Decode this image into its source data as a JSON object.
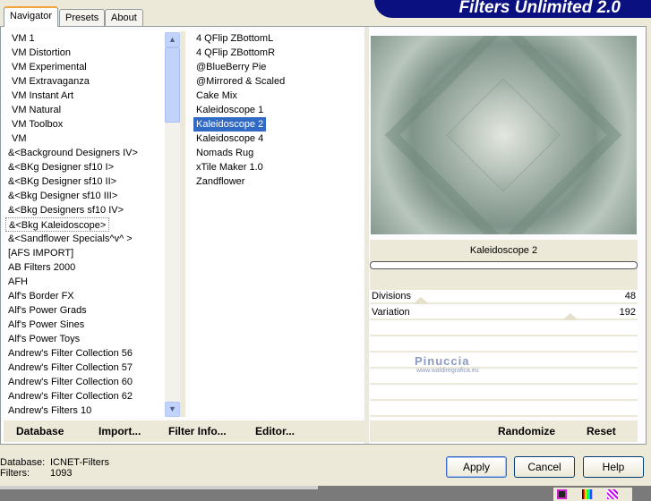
{
  "app": {
    "title": "Filters Unlimited 2.0"
  },
  "tabs": [
    {
      "label": "Navigator"
    },
    {
      "label": "Presets"
    },
    {
      "label": "About"
    }
  ],
  "categories": [
    "VM 1",
    "VM Distortion",
    "VM Experimental",
    "VM Extravaganza",
    "VM Instant Art",
    "VM Natural",
    "VM Toolbox",
    "VM",
    "&<Background Designers IV>",
    "&<BKg Designer sf10 I>",
    "&<BKg Designer sf10 II>",
    "&<Bkg Designer sf10 III>",
    "&<Bkg Designers sf10 IV>",
    "&<Bkg Kaleidoscope>",
    "&<Sandflower Specials^v^ >",
    "[AFS IMPORT]",
    "AB Filters 2000",
    "AFH",
    "Alf's Border FX",
    "Alf's Power Grads",
    "Alf's Power Sines",
    "Alf's Power Toys",
    "Andrew's Filter Collection 56",
    "Andrew's Filter Collection 57",
    "Andrew's Filter Collection 60",
    "Andrew's Filter Collection 62",
    "Andrew's Filters 10"
  ],
  "selected_category": "&<Bkg Kaleidoscope>",
  "filters": [
    "4 QFlip ZBottomL",
    "4 QFlip ZBottomR",
    "@BlueBerry Pie",
    "@Mirrored & Scaled",
    "Cake Mix",
    "Kaleidoscope 1",
    "Kaleidoscope 2",
    "Kaleidoscope 4",
    "Nomads Rug",
    "xTile Maker 1.0",
    "Zandflower"
  ],
  "selected_filter": "Kaleidoscope 2",
  "filter_name": "Kaleidoscope 2",
  "params": [
    {
      "label": "Divisions",
      "value": "48",
      "fraction": 0.19
    },
    {
      "label": "Variation",
      "value": "192",
      "fraction": 0.75
    }
  ],
  "watermark": {
    "name": "Pinuccia",
    "url": "www.waldiregrafica.eu"
  },
  "bottom_buttons": {
    "database": "Database",
    "import": "Import...",
    "filter_info": "Filter Info...",
    "editor": "Editor...",
    "randomize": "Randomize",
    "reset": "Reset"
  },
  "status": {
    "database_label": "Database:",
    "database_value": "ICNET-Filters",
    "filters_label": "Filters:",
    "filters_value": "1093"
  },
  "dialog": {
    "apply": "Apply",
    "cancel": "Cancel",
    "help": "Help"
  }
}
